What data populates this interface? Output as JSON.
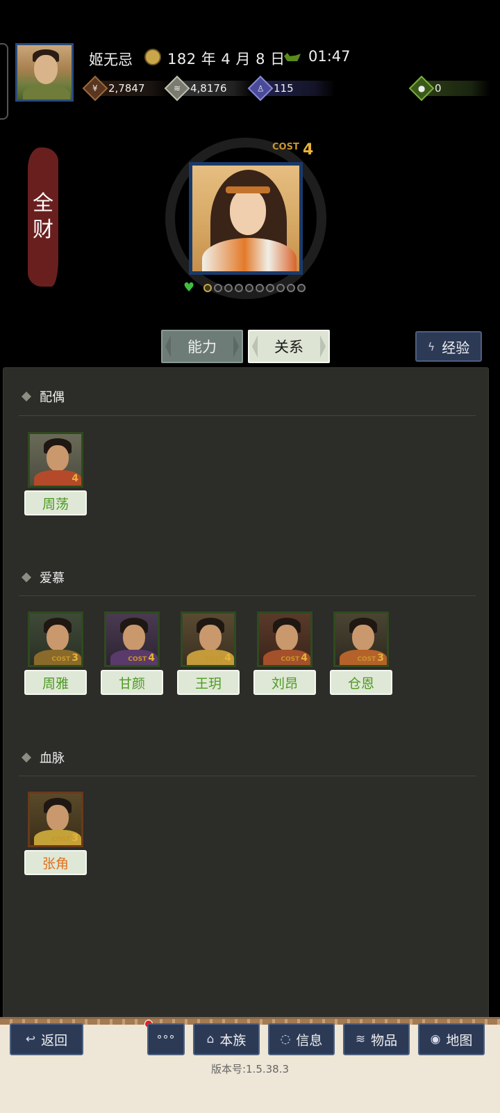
{
  "header": {
    "player_name": "姬无忌",
    "date": "182 年 4 月 8 日",
    "time": "01:47",
    "resources": {
      "money": "2,7847",
      "food": "4,8176",
      "soldiers": "115",
      "gems": "0"
    }
  },
  "character": {
    "banner_line1": "全",
    "banner_line2": "财",
    "cost_label": "COST",
    "cost_value": "4",
    "stars_total": 10
  },
  "tabs": {
    "ability": "能力",
    "relation": "关系",
    "experience": "经验",
    "selected": "关系"
  },
  "sections": {
    "spouse": {
      "title": "配偶",
      "members": [
        {
          "name": "周荡",
          "cost": "4"
        }
      ]
    },
    "admire": {
      "title": "爱慕",
      "members": [
        {
          "name": "周雅",
          "cost": "3"
        },
        {
          "name": "甘颜",
          "cost": "4"
        },
        {
          "name": "王玥",
          "cost": "4"
        },
        {
          "name": "刘昂",
          "cost": "4"
        },
        {
          "name": "仓恩",
          "cost": "3"
        }
      ]
    },
    "bloodline": {
      "title": "血脉",
      "members": [
        {
          "name": "张角",
          "cost": "3"
        }
      ]
    }
  },
  "cost_tag": "COST",
  "bottom_nav": {
    "back": "返回",
    "more": "°°°",
    "clan": "本族",
    "info": "信息",
    "items": "物品",
    "map": "地图"
  },
  "version": "版本号:1.5.38.3",
  "colors": {
    "panel": "#2c2c28",
    "name_green": "#4d9a22",
    "name_orange": "#e2701c",
    "button_navy": "#2c3a56"
  }
}
